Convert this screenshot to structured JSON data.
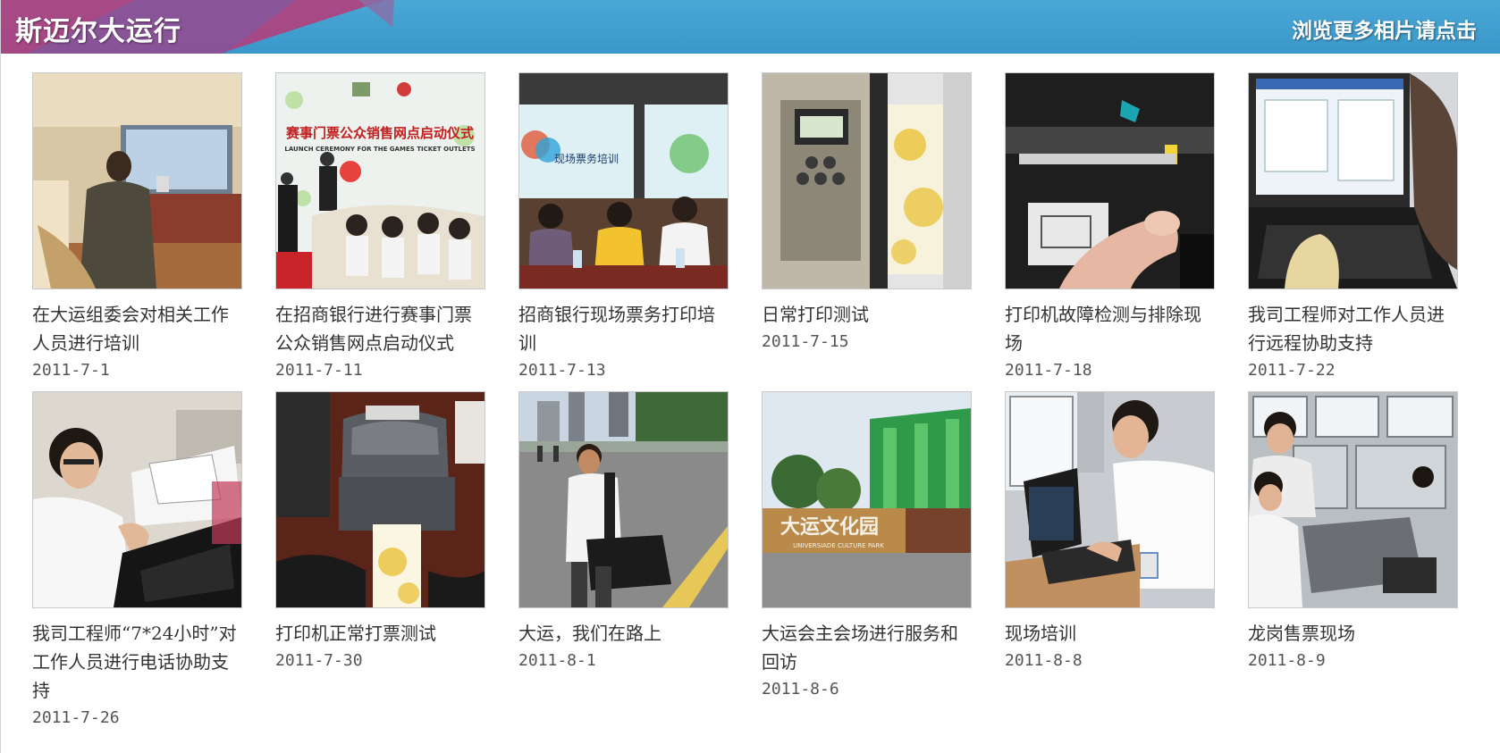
{
  "header": {
    "title": "斯迈尔大运行",
    "more_link": "浏览更多相片请点击"
  },
  "gallery": [
    {
      "caption": "在大运组委会对相关工作人员进行培训",
      "date": "2011-7-1"
    },
    {
      "caption": "在招商银行进行赛事门票公众销售网点启动仪式",
      "date": "2011-7-11"
    },
    {
      "caption": "招商银行现场票务打印培训",
      "date": "2011-7-13"
    },
    {
      "caption": "日常打印测试",
      "date": "2011-7-15"
    },
    {
      "caption": "打印机故障检测与排除现场",
      "date": "2011-7-18"
    },
    {
      "caption": "我司工程师对工作人员进行远程协助支持",
      "date": "2011-7-22"
    },
    {
      "caption": "我司工程师“7*24小时”对工作人员进行电话协助支持",
      "date": "2011-7-26"
    },
    {
      "caption": "打印机正常打票测试",
      "date": "2011-7-30"
    },
    {
      "caption": "大运，我们在路上",
      "date": "2011-8-1"
    },
    {
      "caption": "大运会主会场进行服务和回访",
      "date": "2011-8-6"
    },
    {
      "caption": "现场培训",
      "date": "2011-8-8"
    },
    {
      "caption": "龙岗售票现场",
      "date": "2011-8-9"
    }
  ],
  "photo_texts": {
    "ceremony_banner": "赛事门票公众销售网点启动仪式",
    "ceremony_banner_en": "LAUNCH CEREMONY FOR THE GAMES TICKET OUTLETS",
    "training_screen": "现场票务培训",
    "venue_sign": "大运文化园",
    "venue_sign_en": "UNIVERSIADE CULTURE PARK"
  },
  "colors": {
    "header_blue": "#3a97c9",
    "header_accent_magenta": "#b73a78",
    "header_accent_purple": "#7d5aa0"
  }
}
